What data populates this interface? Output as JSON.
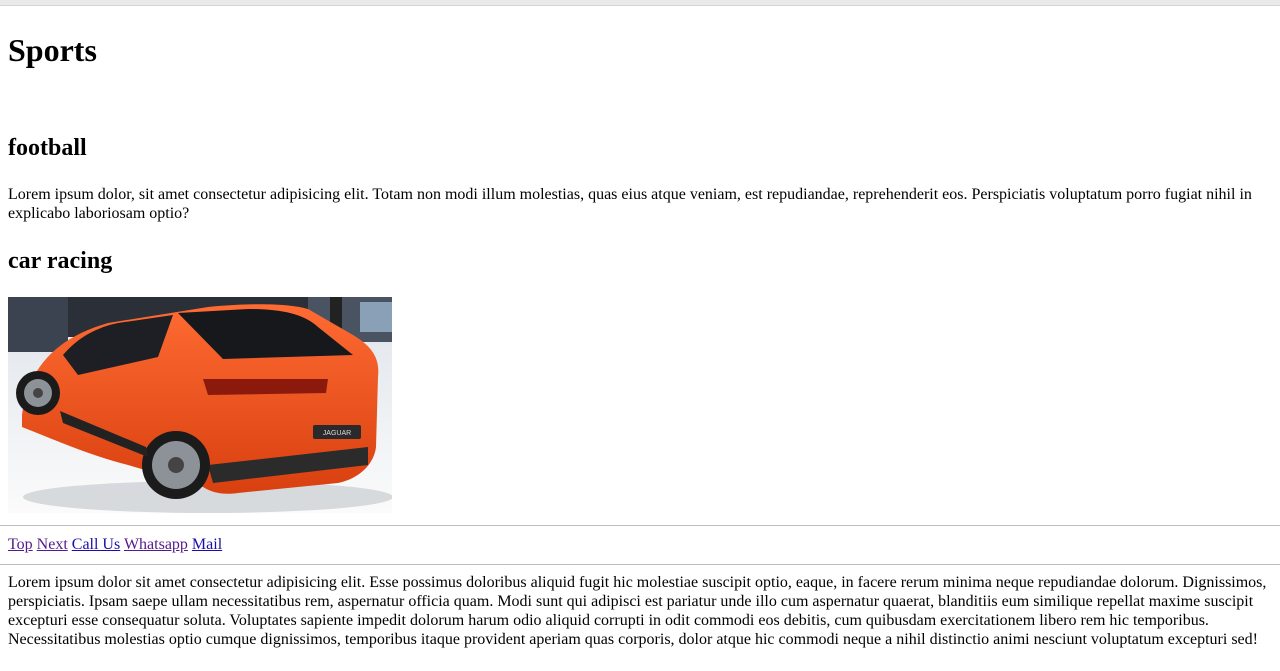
{
  "page": {
    "title": "Sports"
  },
  "sections": {
    "football": {
      "heading": "football",
      "text": "Lorem ipsum dolor, sit amet consectetur adipisicing elit. Totam non modi illum molestias, quas eius atque veniam, est repudiandae, reprehenderit eos. Perspiciatis voluptatum porro fugiat nihil in explicabo laboriosam optio?"
    },
    "car_racing": {
      "heading": "car racing",
      "image_subject": "orange Jaguar I-PACE car at auto show",
      "plate_text": "JAGUAR"
    }
  },
  "nav": {
    "links": [
      "Top",
      "Next",
      "Call Us",
      "Whatsapp",
      "Mail"
    ]
  },
  "footer_text": "Lorem ipsum dolor sit amet consectetur adipisicing elit. Esse possimus doloribus aliquid fugit hic molestiae suscipit optio, eaque, in facere rerum minima neque repudiandae dolorum. Dignissimos, perspiciatis. Ipsam saepe ullam necessitatibus rem, aspernatur officia quam. Modi sunt qui adipisci est pariatur unde illo cum aspernatur quaerat, blanditiis eum similique repellat maxime suscipit excepturi esse consequatur soluta. Voluptates sapiente impedit dolorum harum odio aliquid corrupti in odit commodi eos debitis, cum quibusdam exercitationem libero rem hic temporibus. Necessitatibus molestias optio cumque dignissimos, temporibus itaque provident aperiam quas corporis, dolor atque hic commodi neque a nihil distinctio animi nesciunt voluptatum excepturi sed!",
  "colors": {
    "link": "#1a0dab",
    "visited_link": "#551a8b",
    "car_body": "#f2521e"
  }
}
